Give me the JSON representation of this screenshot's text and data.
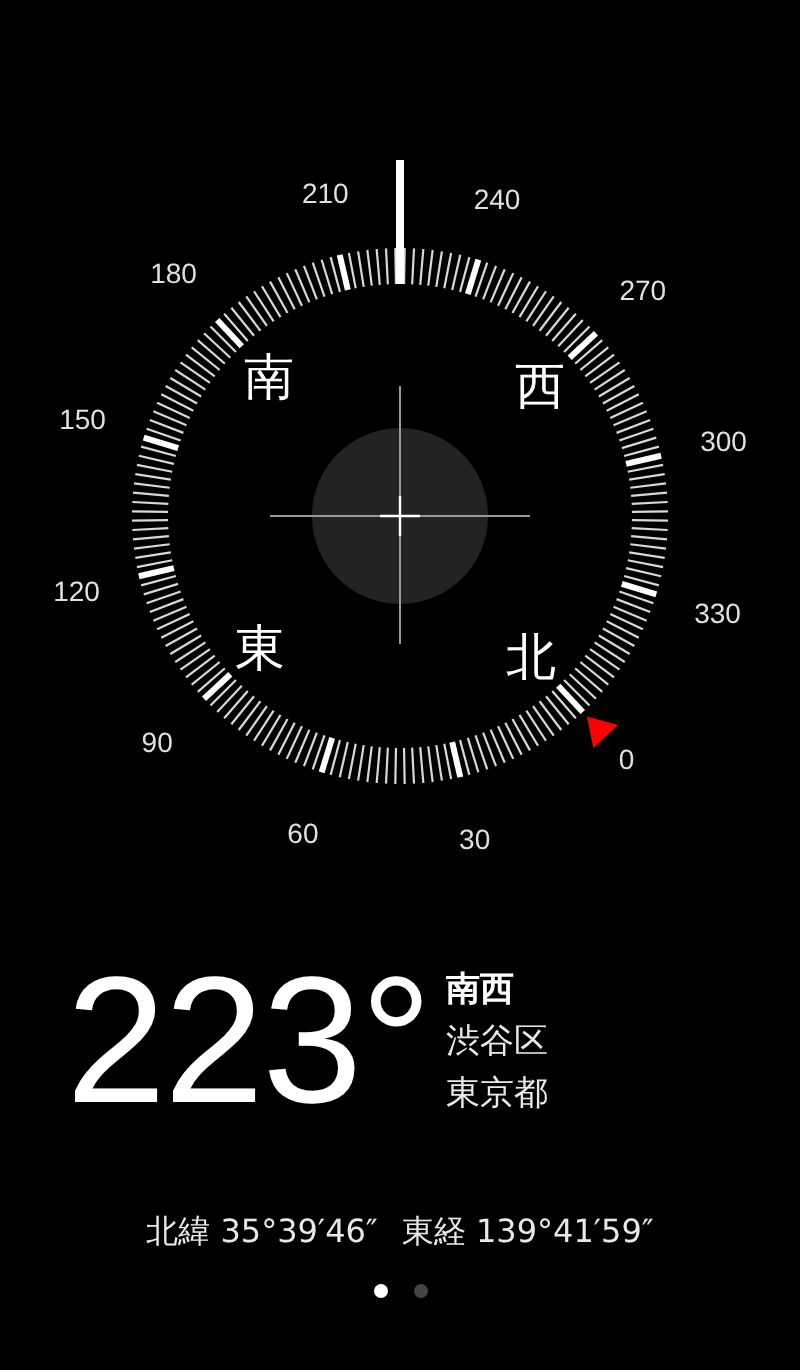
{
  "compass": {
    "degree_labels": [
      "0",
      "30",
      "60",
      "90",
      "120",
      "150",
      "180",
      "210",
      "240",
      "270",
      "300",
      "330"
    ],
    "cardinal_labels": [
      {
        "kind": "south",
        "text": "南"
      },
      {
        "kind": "west",
        "text": "西"
      },
      {
        "kind": "east",
        "text": "東"
      },
      {
        "kind": "north",
        "text": "北"
      }
    ]
  },
  "reading": {
    "heading": "223°",
    "direction": "南西",
    "district": "渋谷区",
    "prefecture": "東京都"
  },
  "coordinates": {
    "latitude": "北緯 35°39′46″",
    "longitude": "東経 139°41′59″"
  },
  "pages": [
    {
      "selected": true
    },
    {
      "selected": false
    }
  ]
}
